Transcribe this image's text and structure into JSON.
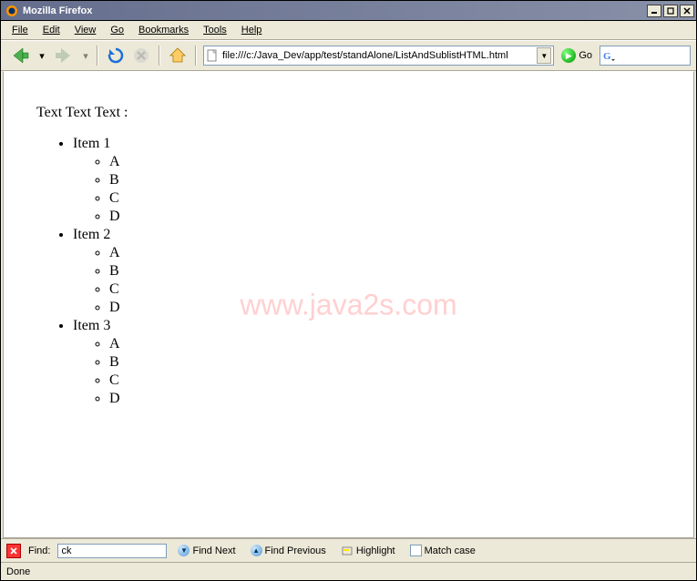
{
  "window": {
    "title": "Mozilla Firefox"
  },
  "menu": {
    "file": "File",
    "edit": "Edit",
    "view": "View",
    "go": "Go",
    "bookmarks": "Bookmarks",
    "tools": "Tools",
    "help": "Help"
  },
  "toolbar": {
    "url": "file:///c:/Java_Dev/app/test/standAlone/ListAndSublistHTML.html",
    "go_label": "Go"
  },
  "page": {
    "intro": "Text Text Text :",
    "list": [
      {
        "label": "Item 1",
        "sub": [
          "A",
          "B",
          "C",
          "D"
        ]
      },
      {
        "label": "Item 2",
        "sub": [
          "A",
          "B",
          "C",
          "D"
        ]
      },
      {
        "label": "Item 3",
        "sub": [
          "A",
          "B",
          "C",
          "D"
        ]
      }
    ],
    "watermark": "www.java2s.com"
  },
  "findbar": {
    "label": "Find:",
    "value": "ck",
    "find_next": "Find Next",
    "find_previous": "Find Previous",
    "highlight": "Highlight",
    "match_case": "Match case"
  },
  "status": {
    "text": "Done"
  }
}
